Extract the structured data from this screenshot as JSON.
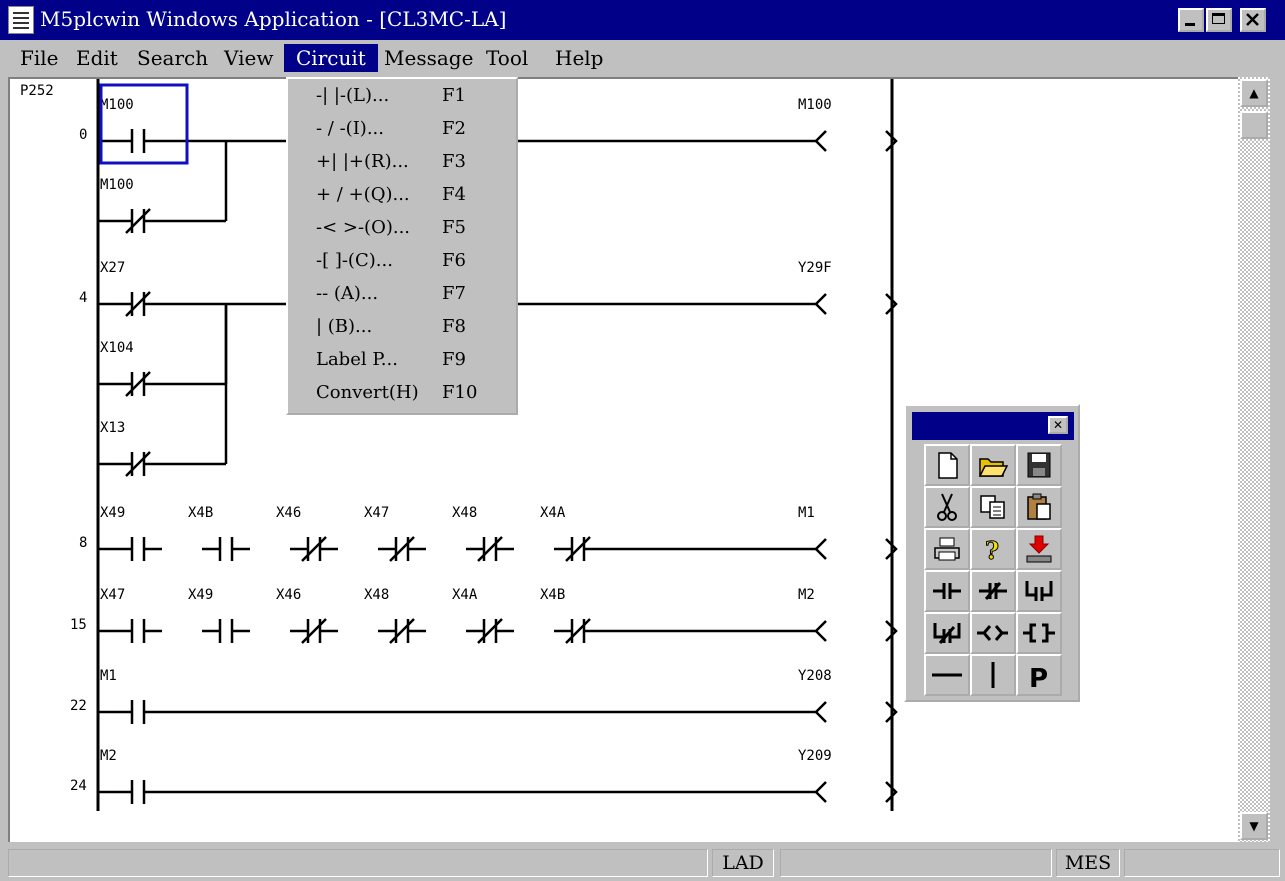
{
  "window": {
    "title": "M5plcwin Windows Application - [CL3MC-LA]"
  },
  "menubar": {
    "items": [
      "File",
      "Edit",
      "Search",
      "View",
      "Circuit",
      "Message",
      "Tool",
      "Help"
    ],
    "active": "Circuit"
  },
  "circuit_menu": {
    "items": [
      {
        "label": "-| |-(L)...",
        "key": "F1"
      },
      {
        "label": "- / -(I)...",
        "key": "F2"
      },
      {
        "label": "+| |+(R)...",
        "key": "F3"
      },
      {
        "label": "+ / +(Q)...",
        "key": "F4"
      },
      {
        "label": "-< >-(O)...",
        "key": "F5"
      },
      {
        "label": "-[ ]-(C)...",
        "key": "F6"
      },
      {
        "label": "-- (A)...",
        "key": "F7"
      },
      {
        "label": "| (B)...",
        "key": "F8"
      },
      {
        "label": "Label P...",
        "key": "F9"
      },
      {
        "label": "Convert(H)",
        "key": "F10"
      }
    ]
  },
  "ladder": {
    "page": "P252",
    "rungs": [
      {
        "step": "0",
        "output": "M100",
        "contacts": [
          {
            "name": "M100",
            "nc": false
          }
        ],
        "branches": [
          {
            "name": "M100",
            "nc": true
          }
        ]
      },
      {
        "step": "4",
        "output": "Y29F",
        "contacts": [
          {
            "name": "X27",
            "nc": true
          }
        ],
        "branches": [
          {
            "name": "X104",
            "nc": true
          },
          {
            "name": "X13",
            "nc": true
          }
        ]
      },
      {
        "step": "8",
        "output": "M1",
        "contacts": [
          {
            "name": "X49",
            "nc": false
          },
          {
            "name": "X4B",
            "nc": false
          },
          {
            "name": "X46",
            "nc": true
          },
          {
            "name": "X47",
            "nc": true
          },
          {
            "name": "X48",
            "nc": true
          },
          {
            "name": "X4A",
            "nc": true
          }
        ],
        "branches": []
      },
      {
        "step": "15",
        "output": "M2",
        "contacts": [
          {
            "name": "X47",
            "nc": false
          },
          {
            "name": "X49",
            "nc": false
          },
          {
            "name": "X46",
            "nc": true
          },
          {
            "name": "X48",
            "nc": true
          },
          {
            "name": "X4A",
            "nc": true
          },
          {
            "name": "X4B",
            "nc": true
          }
        ],
        "branches": []
      },
      {
        "step": "22",
        "output": "Y208",
        "contacts": [
          {
            "name": "M1",
            "nc": false
          }
        ],
        "branches": []
      },
      {
        "step": "24",
        "output": "Y209",
        "contacts": [
          {
            "name": "M2",
            "nc": false
          }
        ],
        "branches": []
      }
    ]
  },
  "toolbox": {
    "buttons": [
      "new-file",
      "open-folder",
      "save-disk",
      "cut-scissors",
      "copy",
      "paste",
      "print",
      "help-question",
      "transfer",
      "contact-no",
      "contact-nc",
      "parallel-no",
      "parallel-nc",
      "coil",
      "function",
      "horizontal-line",
      "vertical-line",
      "label-p"
    ]
  },
  "statusbar": {
    "mode": "LAD",
    "msg": "MES"
  }
}
